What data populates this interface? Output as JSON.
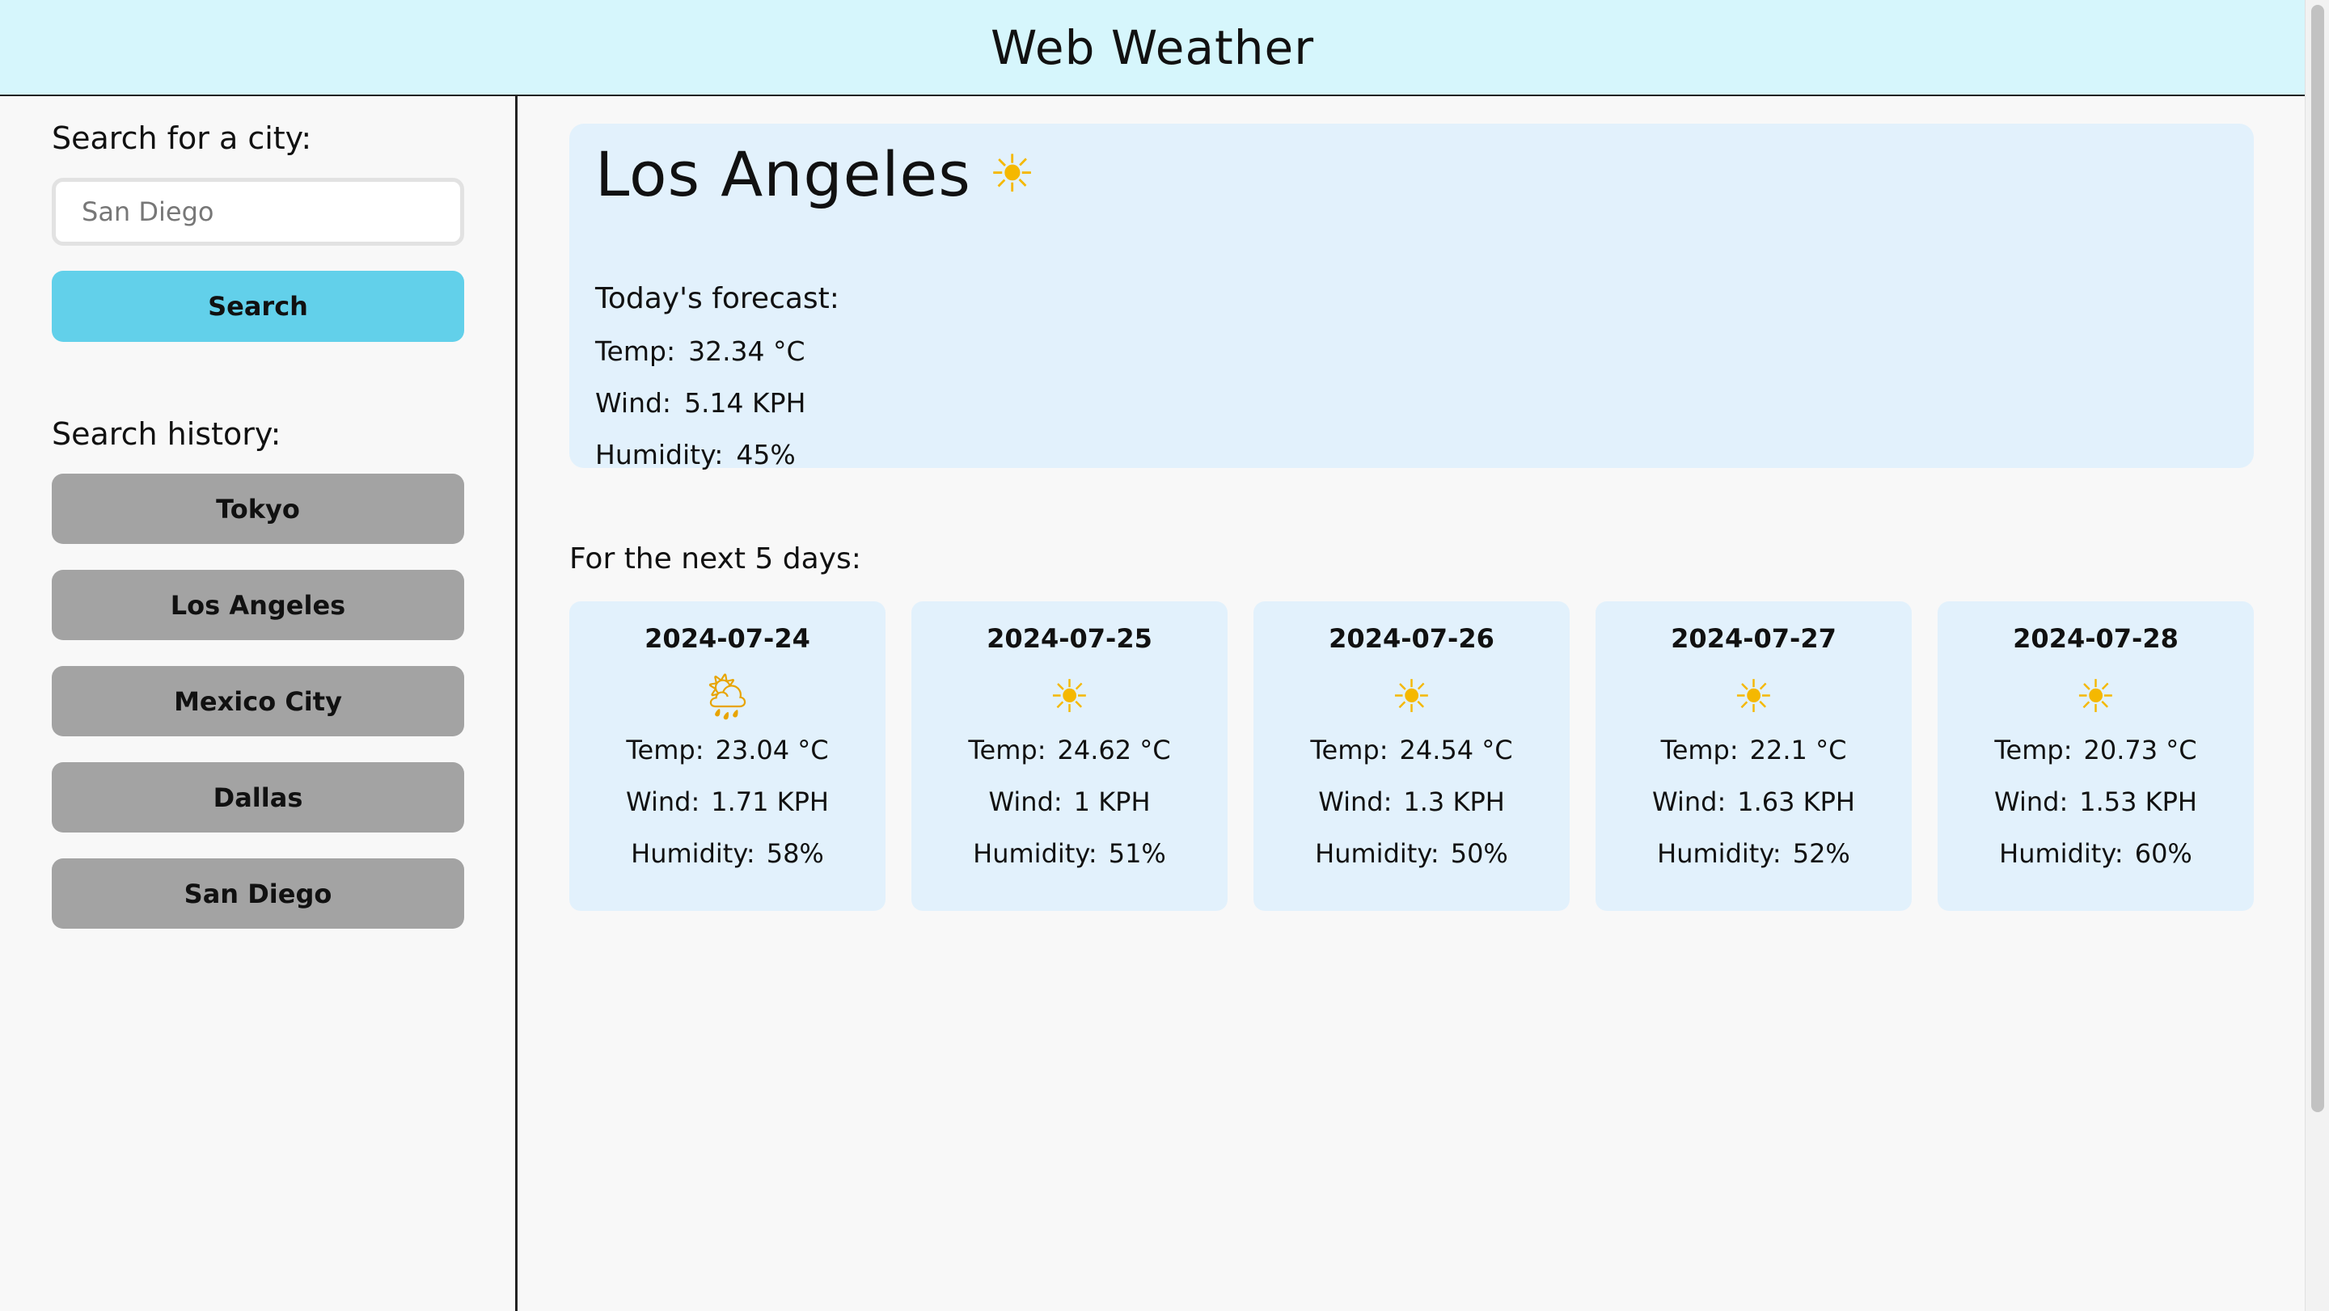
{
  "header": {
    "title": "Web Weather"
  },
  "sidebar": {
    "search_label": "Search for a city:",
    "search_placeholder": "San Diego",
    "search_button": "Search",
    "history_label": "Search history:",
    "history": [
      "Tokyo",
      "Los Angeles",
      "Mexico City",
      "Dallas",
      "San Diego"
    ]
  },
  "current": {
    "city": "Los Angeles",
    "icon": "sun-icon",
    "today_label": "Today's forecast:",
    "temp_label": "Temp:",
    "temp": "32.34 °C",
    "wind_label": "Wind:",
    "wind": "5.14 KPH",
    "humidity_label": "Humidity:",
    "humidity": "45%"
  },
  "forecast": {
    "label": "For the next 5 days:",
    "temp_label": "Temp:",
    "wind_label": "Wind:",
    "humidity_label": "Humidity:",
    "days": [
      {
        "date": "2024-07-24",
        "icon": "cloud-rain-sun-icon",
        "temp": "23.04 °C",
        "wind": "1.71 KPH",
        "humidity": "58%"
      },
      {
        "date": "2024-07-25",
        "icon": "sun-icon",
        "temp": "24.62 °C",
        "wind": "1 KPH",
        "humidity": "51%"
      },
      {
        "date": "2024-07-26",
        "icon": "sun-icon",
        "temp": "24.54 °C",
        "wind": "1.3 KPH",
        "humidity": "50%"
      },
      {
        "date": "2024-07-27",
        "icon": "sun-icon",
        "temp": "22.1 °C",
        "wind": "1.63 KPH",
        "humidity": "52%"
      },
      {
        "date": "2024-07-28",
        "icon": "sun-icon",
        "temp": "20.73 °C",
        "wind": "1.53 KPH",
        "humidity": "60%"
      }
    ]
  },
  "colors": {
    "header_bg": "#d6f6fc",
    "search_button": "#62d0ea",
    "history_button": "#a3a3a3",
    "card_bg": "#e2f1fc"
  }
}
